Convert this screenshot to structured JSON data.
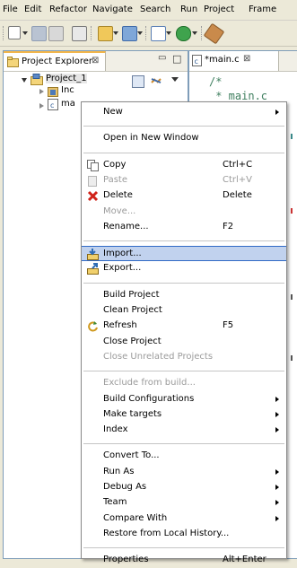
{
  "menubar": [
    "File",
    "Edit",
    "Refactor",
    "Navigate",
    "Search",
    "Run",
    "Project",
    "Frame"
  ],
  "project_explorer": {
    "tab_label": "Project Explorer",
    "close_glyph": "⊠",
    "min_glyph": "▭",
    "max_glyph": "□",
    "tree": {
      "project": "Project_1",
      "children": [
        "Inc",
        "ma"
      ]
    }
  },
  "editor": {
    "tab_label": "*main.c",
    "close_glyph": "⊠",
    "code_lines": [
      "/*",
      " * main.c"
    ]
  },
  "context_menu": {
    "items": [
      {
        "label": "New",
        "submenu": true,
        "icon": null
      },
      {
        "sep": true
      },
      {
        "label": "Open in New Window",
        "icon": null
      },
      {
        "sep": true
      },
      {
        "label": "Copy",
        "shortcut": "Ctrl+C",
        "icon": "copy-icon"
      },
      {
        "label": "Paste",
        "shortcut": "Ctrl+V",
        "disabled": true,
        "icon": "paste-icon"
      },
      {
        "label": "Delete",
        "shortcut": "Delete",
        "icon": "delete-icon"
      },
      {
        "label": "Move...",
        "disabled": true,
        "icon": null
      },
      {
        "label": "Rename...",
        "shortcut": "F2",
        "icon": null
      },
      {
        "sep": true
      },
      {
        "label": "Import...",
        "icon": "import-icon",
        "highlighted": true
      },
      {
        "label": "Export...",
        "icon": "export-icon"
      },
      {
        "sep": true
      },
      {
        "label": "Build Project",
        "icon": null
      },
      {
        "label": "Clean Project",
        "icon": null
      },
      {
        "label": "Refresh",
        "shortcut": "F5",
        "icon": "refresh-icon"
      },
      {
        "label": "Close Project",
        "icon": null
      },
      {
        "label": "Close Unrelated Projects",
        "disabled": true,
        "icon": null
      },
      {
        "sep": true
      },
      {
        "label": "Exclude from build...",
        "disabled": true,
        "icon": null
      },
      {
        "label": "Build Configurations",
        "submenu": true,
        "icon": null
      },
      {
        "label": "Make targets",
        "submenu": true,
        "icon": null
      },
      {
        "label": "Index",
        "submenu": true,
        "icon": null
      },
      {
        "sep": true
      },
      {
        "label": "Convert To...",
        "icon": null
      },
      {
        "label": "Run As",
        "submenu": true,
        "icon": null
      },
      {
        "label": "Debug As",
        "submenu": true,
        "icon": null
      },
      {
        "label": "Team",
        "submenu": true,
        "icon": null
      },
      {
        "label": "Compare With",
        "submenu": true,
        "icon": null
      },
      {
        "label": "Restore from Local History...",
        "icon": null
      },
      {
        "sep": true
      },
      {
        "label": "Properties",
        "shortcut": "Alt+Enter",
        "icon": null
      }
    ]
  }
}
